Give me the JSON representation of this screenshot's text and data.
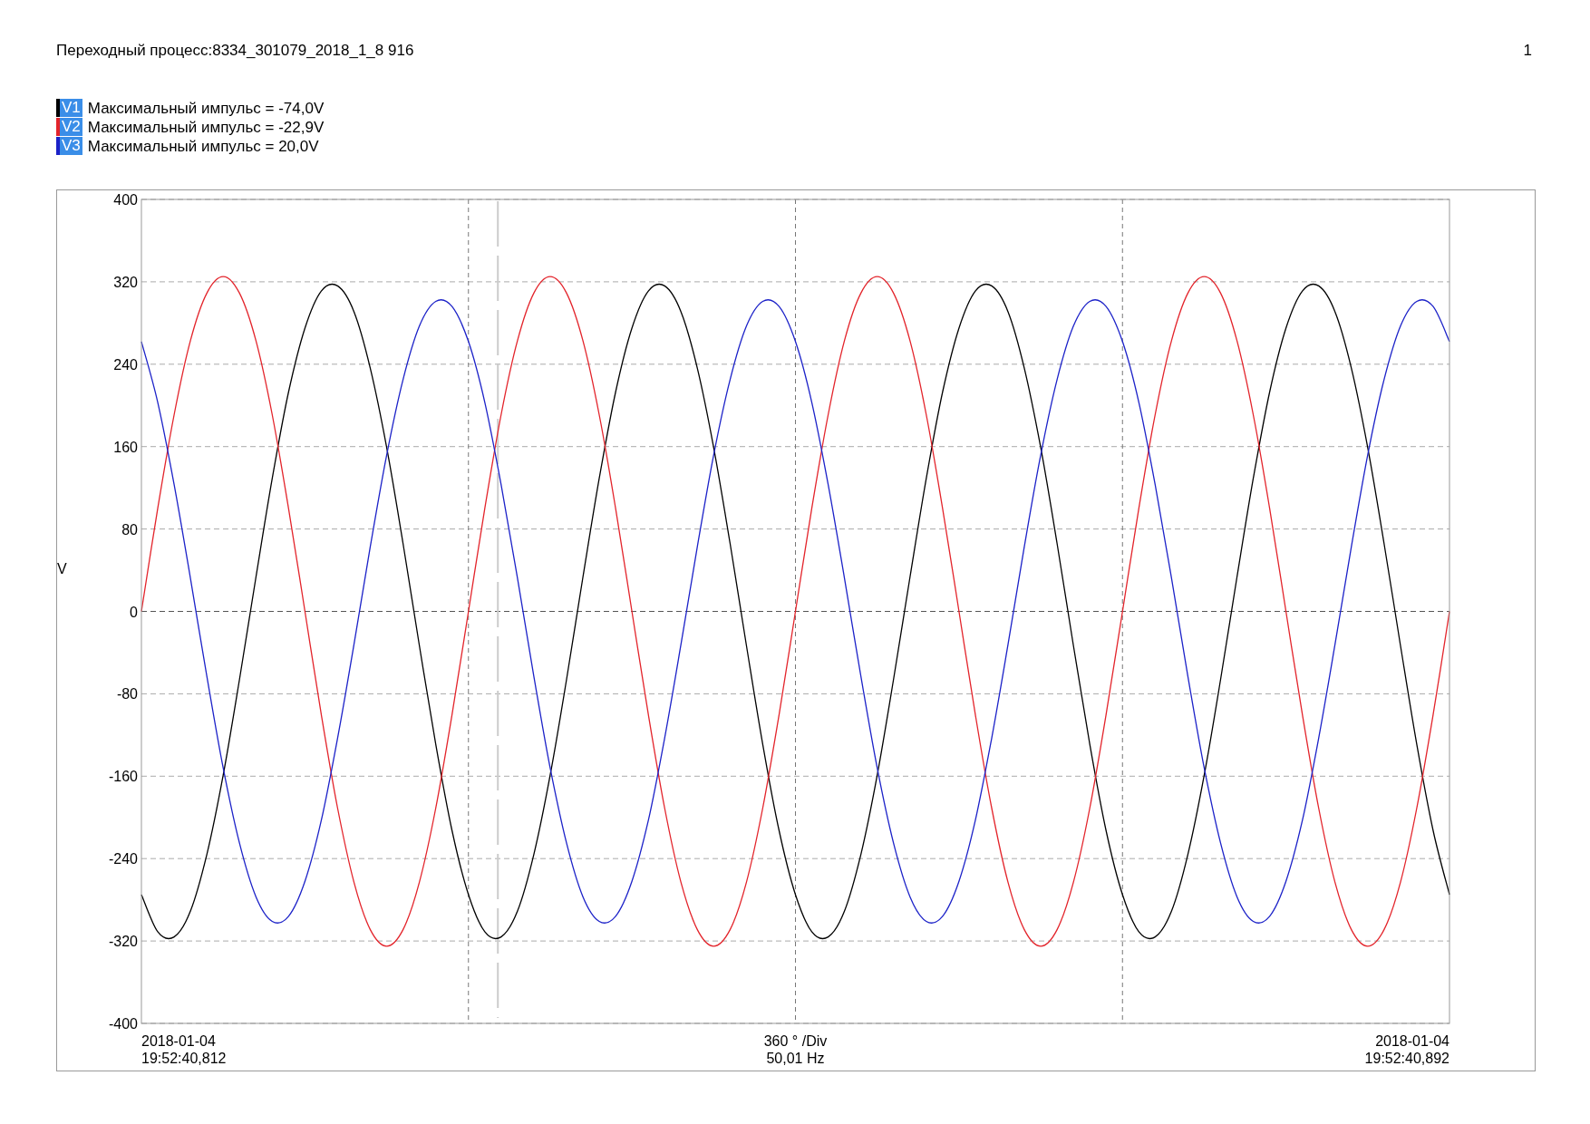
{
  "header": {
    "title": "Переходный процесс:8334_301079_2018_1_8 916",
    "page": "1"
  },
  "legend": [
    {
      "text": "Максимальный импульс = -74,0V"
    },
    {
      "text": "Максимальный импульс = -22,9V"
    },
    {
      "text": "Максимальный импульс = 20,0V"
    }
  ],
  "chart": {
    "start_labels": [
      "2018-01-04",
      "19:52:40,812"
    ],
    "center_labels": [
      "360 ° /Div",
      "50,01 Hz"
    ],
    "end_labels": [
      "2018-01-04",
      "19:52:40,892"
    ],
    "chart_data": {
      "type": "line",
      "ylabel": "V",
      "ylim": [
        -400,
        400
      ],
      "yticks": [
        -400,
        -320,
        -240,
        -160,
        -80,
        0,
        80,
        160,
        240,
        320,
        400
      ],
      "grid": true,
      "ref_lines": [
        {
          "axis": "y",
          "value": 0
        }
      ],
      "series": [
        {
          "name": "V1",
          "color": "#000000",
          "values": [
            -275,
            -311,
            -316,
            -291,
            -236,
            -159,
            -66,
            33,
            129,
            213,
            275,
            311,
            316,
            291,
            236,
            159,
            66,
            -33,
            -129,
            -213,
            -275,
            -311,
            -316,
            -291,
            -236,
            -159,
            -66,
            33,
            129,
            213,
            275,
            311,
            316,
            291,
            236,
            159,
            66,
            -33,
            -129,
            -213,
            -275,
            -311,
            -316,
            -291,
            -236,
            -159,
            -66,
            33,
            129,
            213,
            275,
            311,
            316,
            291,
            236,
            159,
            66,
            -33,
            -129,
            -213,
            -275,
            -311,
            -316,
            -291,
            -236,
            -159,
            -66,
            33,
            129,
            213,
            275,
            311,
            316,
            291,
            236,
            159,
            66,
            -33,
            -129,
            -213,
            -275
          ]
        },
        {
          "name": "V2",
          "color": "#e3242b",
          "values": [
            0,
            100,
            191,
            263,
            309,
            325,
            309,
            263,
            191,
            100,
            0,
            -100,
            -191,
            -263,
            -309,
            -325,
            -309,
            -263,
            -191,
            -100,
            0,
            100,
            191,
            263,
            309,
            325,
            309,
            263,
            191,
            100,
            0,
            -100,
            -191,
            -263,
            -309,
            -325,
            -309,
            -263,
            -191,
            -100,
            0,
            100,
            191,
            263,
            309,
            325,
            309,
            263,
            191,
            100,
            0,
            -100,
            -191,
            -263,
            -309,
            -325,
            -309,
            -263,
            -191,
            -100,
            0,
            100,
            191,
            263,
            309,
            325,
            309,
            263,
            191,
            100,
            0,
            -100,
            -191,
            -263,
            -309,
            -325,
            -309,
            -263,
            -191,
            -100,
            0
          ]
        },
        {
          "name": "V3",
          "color": "#1c22c8",
          "values": [
            262,
            203,
            123,
            32,
            -63,
            -152,
            -225,
            -277,
            -301,
            -296,
            -262,
            -203,
            -123,
            -32,
            63,
            152,
            225,
            277,
            301,
            296,
            262,
            203,
            123,
            32,
            -63,
            -152,
            -225,
            -277,
            -301,
            -296,
            -262,
            -203,
            -123,
            -32,
            63,
            152,
            225,
            277,
            301,
            296,
            262,
            203,
            123,
            32,
            -63,
            -152,
            -225,
            -277,
            -301,
            -296,
            -262,
            -203,
            -123,
            -32,
            63,
            152,
            225,
            277,
            301,
            296,
            262,
            203,
            123,
            32,
            -63,
            -152,
            -225,
            -277,
            -301,
            -296,
            -262,
            -203,
            -123,
            -32,
            63,
            152,
            225,
            277,
            301,
            296,
            262
          ]
        }
      ]
    }
  }
}
